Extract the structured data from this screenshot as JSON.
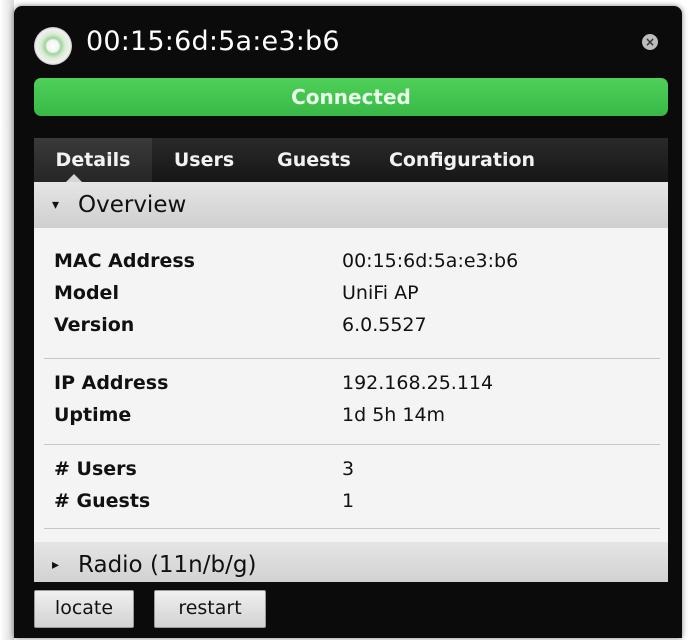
{
  "window": {
    "title": "00:15:6d:5a:e3:b6",
    "close_icon": "×",
    "status_text": "Connected",
    "status_color": "#3ec14d"
  },
  "tabs": [
    {
      "label": "Details",
      "active": true
    },
    {
      "label": "Users",
      "active": false
    },
    {
      "label": "Guests",
      "active": false
    },
    {
      "label": "Configuration",
      "active": false
    }
  ],
  "overview": {
    "label": "Overview",
    "arrow": "▾",
    "groups": [
      [
        {
          "key": "MAC Address",
          "value": "00:15:6d:5a:e3:b6"
        },
        {
          "key": "Model",
          "value": "UniFi AP"
        },
        {
          "key": "Version",
          "value": "6.0.5527"
        }
      ],
      [
        {
          "key": "IP Address",
          "value": "192.168.25.114"
        },
        {
          "key": "Uptime",
          "value": "1d 5h 14m"
        }
      ],
      [
        {
          "key": "# Users",
          "value": "3"
        },
        {
          "key": "# Guests",
          "value": "1"
        }
      ]
    ]
  },
  "radio": {
    "label": "Radio (11n/b/g)",
    "arrow": "▸"
  },
  "actions": {
    "locate_label": "locate",
    "restart_label": "restart"
  }
}
